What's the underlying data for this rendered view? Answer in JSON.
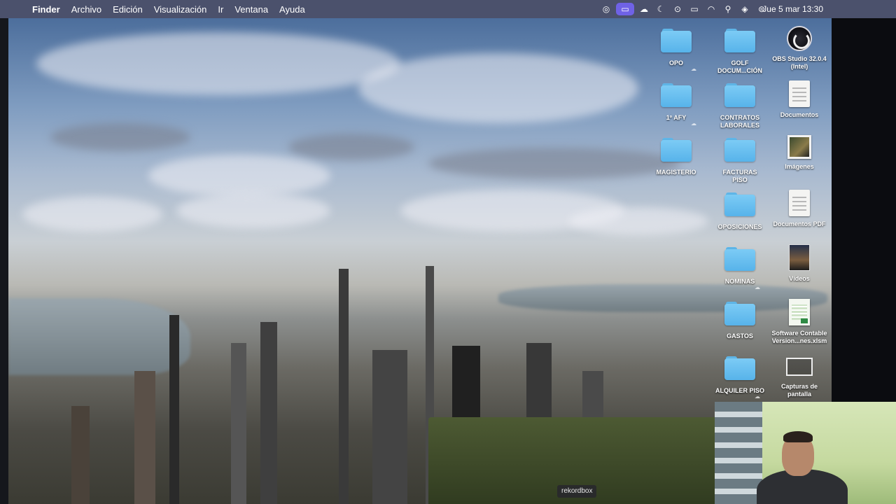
{
  "menubar": {
    "apple_icon": "apple-logo",
    "app_name": "Finder",
    "menus": [
      "Archivo",
      "Edición",
      "Visualización",
      "Ir",
      "Ventana",
      "Ayuda"
    ],
    "status_icons": [
      "status-app-icon",
      "screen-mirror-icon",
      "cloud-icon",
      "focus-moon-icon",
      "record-icon",
      "battery-icon",
      "wifi-icon",
      "spotlight-search-icon",
      "siri-icon",
      "control-center-icon"
    ],
    "clock": "Jue 5 mar 13:30"
  },
  "desktop_icons": [
    {
      "label": "OPO",
      "cloud": true,
      "kind": "folder"
    },
    {
      "label": "GOLF\nDOCUM...CIÓN",
      "kind": "folder"
    },
    {
      "label": "OBS Studio 32.0.4\n(Intel)",
      "kind": "app"
    },
    {
      "label": "1º AFY",
      "cloud": true,
      "kind": "folder"
    },
    {
      "label": "CONTRATOS\nLABORALES",
      "kind": "folder"
    },
    {
      "label": "Documentos",
      "kind": "doc"
    },
    {
      "label": "MAGISTERIO",
      "kind": "folder"
    },
    {
      "label": "FACTURAS\nPISO",
      "kind": "folder"
    },
    {
      "label": "Imágenes",
      "kind": "image"
    },
    {
      "label": "OPOSICIONES",
      "kind": "folder"
    },
    {
      "label": "Documentos PDF",
      "kind": "doc"
    },
    {
      "label": "NOMINAS",
      "cloud": true,
      "kind": "folder"
    },
    {
      "label": "Vídeos",
      "kind": "video"
    },
    {
      "label": "GASTOS",
      "kind": "folder"
    },
    {
      "label": "Software Contable\nVersion...nes.xlsm",
      "kind": "spreadsheet"
    },
    {
      "label": "ALQUILER PISO",
      "cloud": true,
      "kind": "folder"
    },
    {
      "label": "Capturas de\npantalla",
      "kind": "screenshot"
    }
  ],
  "cloud_mark": "☁",
  "tooltip": "rekordbox",
  "colors": {
    "folder": "#6ec1f1",
    "menubar": "#4e5470",
    "active_status": "#6f62e6"
  }
}
